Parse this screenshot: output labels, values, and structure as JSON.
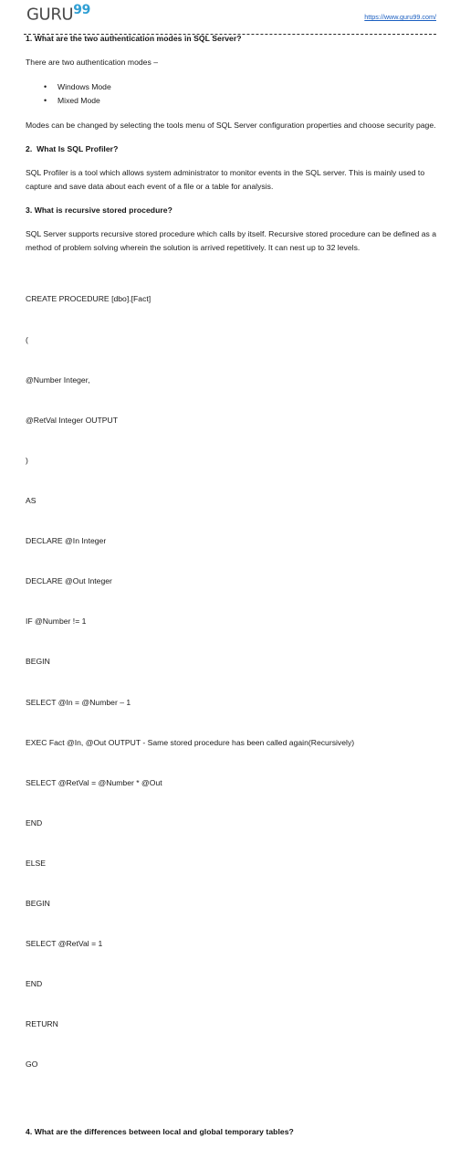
{
  "header": {
    "logo_text": "GURU",
    "logo_suffix": "99",
    "logo_color": "#4a4a4a",
    "logo_suffix_color": "#2f9fd4",
    "site_url": "https://www.guru99.com/",
    "site_url_color": "#1b5fc1",
    "divider_style": "dashed"
  },
  "document": {
    "q1": {
      "heading": "1. What are the two authentication modes in SQL Server?",
      "intro": "There are two authentication modes –",
      "bullets": [
        "Windows Mode",
        "Mixed Mode"
      ],
      "closing": "Modes can be changed by selecting the tools menu of SQL Server configuration properties and choose security page."
    },
    "q2": {
      "heading": "2.  What Is SQL Profiler?",
      "answer": "SQL Profiler is a tool which allows system administrator to monitor events in the SQL server.  This is mainly used to capture and save data about each event of a file or a table for analysis."
    },
    "q3": {
      "heading": "3. What is recursive stored procedure?",
      "answer": "SQL Server supports recursive stored procedure which calls by itself. Recursive stored procedure can be defined as a method of problem solving wherein the solution is arrived repetitively. It can nest up to 32 levels.",
      "code_lines": [
        "CREATE PROCEDURE [dbo].[Fact]",
        "(",
        "@Number Integer,",
        "@RetVal Integer OUTPUT",
        ")",
        "AS",
        "DECLARE @In Integer",
        "DECLARE @Out Integer",
        "IF @Number != 1",
        "BEGIN",
        "SELECT @In = @Number – 1",
        "EXEC Fact @In, @Out OUTPUT - Same stored procedure has been called again(Recursively)",
        "SELECT @RetVal = @Number * @Out",
        "END",
        "ELSE",
        "BEGIN",
        "SELECT @RetVal = 1",
        "END",
        "RETURN",
        "GO"
      ]
    },
    "q4": {
      "heading": "4. What are the differences between local and global temporary tables?"
    }
  }
}
